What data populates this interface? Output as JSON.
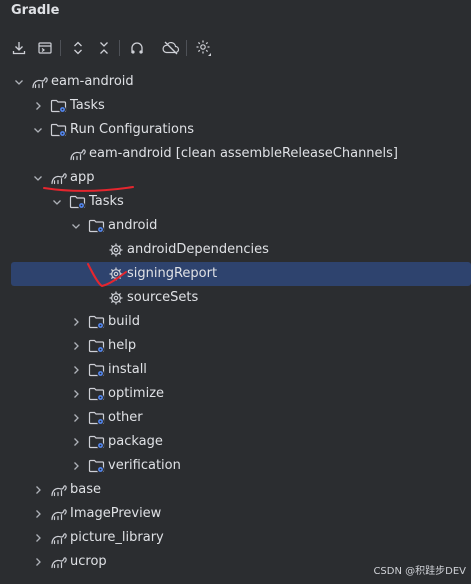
{
  "panel": {
    "title": "Gradle"
  },
  "toolbar": {
    "buttons": [
      {
        "name": "download-sources-icon"
      },
      {
        "name": "run-config-icon"
      },
      {
        "name": "expand-all-icon"
      },
      {
        "name": "collapse-all-icon"
      },
      {
        "name": "analyze-dependencies-icon"
      },
      {
        "name": "offline-mode-icon"
      },
      {
        "name": "settings-icon"
      }
    ]
  },
  "tree": [
    {
      "label": "eam-android",
      "icon": "gradle-project-icon",
      "depth": 0,
      "arrow": "down"
    },
    {
      "label": "Tasks",
      "icon": "folder-gear-icon",
      "depth": 1,
      "arrow": "right"
    },
    {
      "label": "Run Configurations",
      "icon": "folder-gear-icon",
      "depth": 1,
      "arrow": "down"
    },
    {
      "label": "eam-android [clean assembleReleaseChannels]",
      "icon": "gradle-project-icon",
      "depth": 2,
      "arrow": "none"
    },
    {
      "label": "app",
      "icon": "gradle-project-icon",
      "depth": 1,
      "arrow": "down"
    },
    {
      "label": "Tasks",
      "icon": "folder-gear-icon",
      "depth": 2,
      "arrow": "down"
    },
    {
      "label": "android",
      "icon": "folder-gear-icon",
      "depth": 3,
      "arrow": "down"
    },
    {
      "label": "androidDependencies",
      "icon": "gear-icon",
      "depth": 4,
      "arrow": "none"
    },
    {
      "label": "signingReport",
      "icon": "gear-icon",
      "depth": 4,
      "arrow": "none",
      "selected": true
    },
    {
      "label": "sourceSets",
      "icon": "gear-icon",
      "depth": 4,
      "arrow": "none"
    },
    {
      "label": "build",
      "icon": "folder-gear-icon",
      "depth": 3,
      "arrow": "right"
    },
    {
      "label": "help",
      "icon": "folder-gear-icon",
      "depth": 3,
      "arrow": "right"
    },
    {
      "label": "install",
      "icon": "folder-gear-icon",
      "depth": 3,
      "arrow": "right"
    },
    {
      "label": "optimize",
      "icon": "folder-gear-icon",
      "depth": 3,
      "arrow": "right"
    },
    {
      "label": "other",
      "icon": "folder-gear-icon",
      "depth": 3,
      "arrow": "right"
    },
    {
      "label": "package",
      "icon": "folder-gear-icon",
      "depth": 3,
      "arrow": "right"
    },
    {
      "label": "verification",
      "icon": "folder-gear-icon",
      "depth": 3,
      "arrow": "right"
    },
    {
      "label": "base",
      "icon": "gradle-project-icon",
      "depth": 1,
      "arrow": "right"
    },
    {
      "label": "ImagePreview",
      "icon": "gradle-project-icon",
      "depth": 1,
      "arrow": "right"
    },
    {
      "label": "picture_library",
      "icon": "gradle-project-icon",
      "depth": 1,
      "arrow": "right"
    },
    {
      "label": "ucrop",
      "icon": "gradle-project-icon",
      "depth": 1,
      "arrow": "right"
    }
  ],
  "watermark": "CSDN @积跬步DEV",
  "colors": {
    "background": "#2b2d30",
    "selection": "#2e436e",
    "annotation": "#e5262e"
  }
}
